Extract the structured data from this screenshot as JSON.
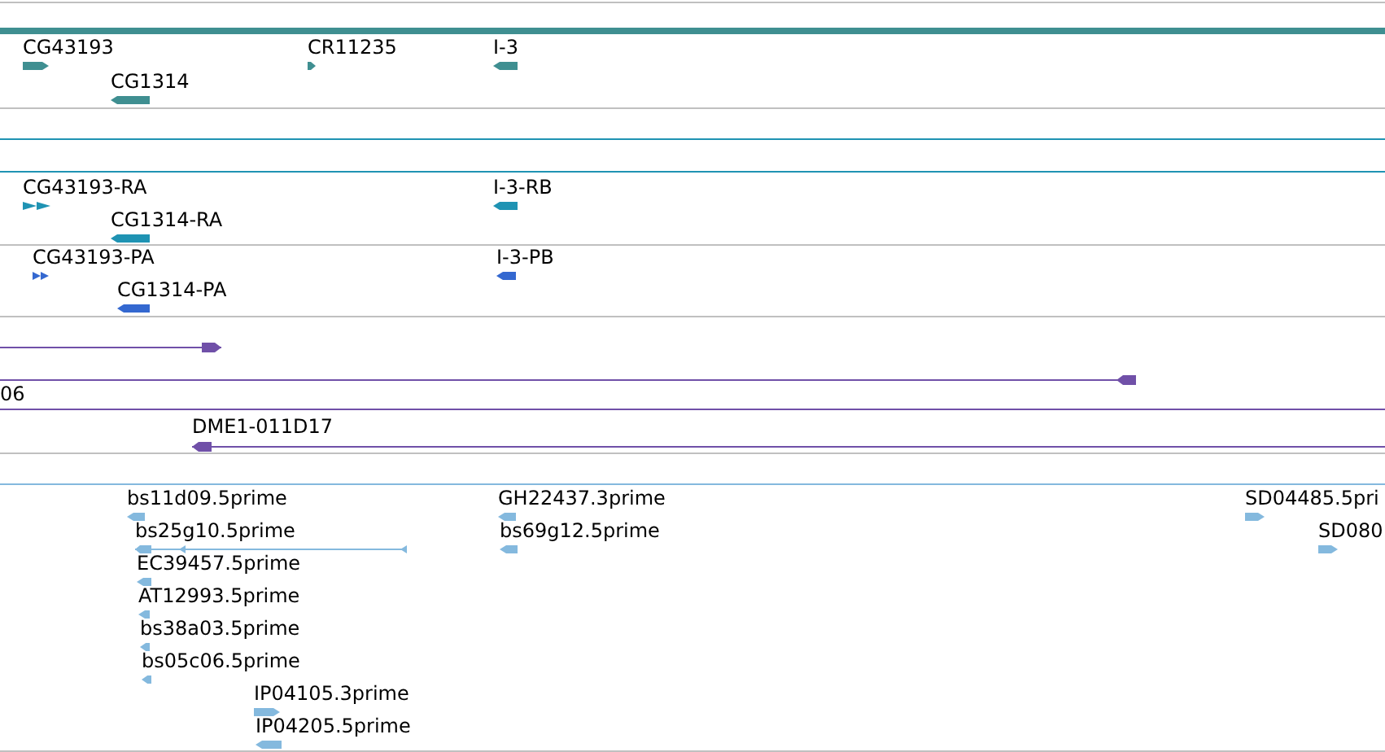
{
  "tracks": [
    {
      "color": "#3f8f91",
      "features": [
        {
          "kind": "bar"
        },
        {
          "kind": "arrow",
          "label": "CG43193",
          "reverse": false
        },
        {
          "kind": "arrow",
          "label": "CR11235",
          "reverse": false
        },
        {
          "kind": "arrow",
          "label": "I-3",
          "reverse": true
        },
        {
          "kind": "arrow",
          "label": "CG1314",
          "reverse": true
        }
      ]
    },
    {
      "color": "#1f93b3",
      "features": [
        {
          "kind": "span"
        },
        {
          "kind": "span"
        },
        {
          "kind": "double",
          "label": "CG43193-RA",
          "reverse": false
        },
        {
          "kind": "arrow",
          "label": "I-3-RB",
          "reverse": true
        },
        {
          "kind": "arrow",
          "label": "CG1314-RA",
          "reverse": true
        }
      ]
    },
    {
      "color": "#3468d0",
      "features": [
        {
          "kind": "double",
          "label": "CG43193-PA",
          "reverse": false
        },
        {
          "kind": "arrow",
          "label": "I-3-PB",
          "reverse": true
        },
        {
          "kind": "arrow",
          "label": "CG1314-PA",
          "reverse": true
        }
      ]
    },
    {
      "color": "#7050a8",
      "features": [
        {
          "kind": "line",
          "reverse": false
        },
        {
          "kind": "line",
          "reverse": true
        },
        {
          "kind": "span",
          "label": "06"
        },
        {
          "kind": "line",
          "label": "DME1-011D17",
          "reverse": true
        }
      ]
    },
    {
      "color": "#84b9de",
      "features": [
        {
          "kind": "span"
        },
        {
          "kind": "arrow",
          "label": "bs11d09.5prime",
          "reverse": true
        },
        {
          "kind": "linked",
          "label": "bs25g10.5prime",
          "reverse": true
        },
        {
          "kind": "arrow",
          "label": "EC39457.5prime",
          "reverse": true
        },
        {
          "kind": "arrow",
          "label": "AT12993.5prime",
          "reverse": true
        },
        {
          "kind": "arrow",
          "label": "bs38a03.5prime",
          "reverse": true
        },
        {
          "kind": "arrow",
          "label": "bs05c06.5prime",
          "reverse": true
        },
        {
          "kind": "arrow",
          "label": "IP04105.3prime",
          "reverse": false
        },
        {
          "kind": "arrow",
          "label": "IP04205.5prime",
          "reverse": true
        },
        {
          "kind": "arrow",
          "label": "GH22437.3prime",
          "reverse": true
        },
        {
          "kind": "arrow",
          "label": "bs69g12.5prime",
          "reverse": true
        },
        {
          "kind": "arrow",
          "label": "SD04485.5pri",
          "reverse": false
        },
        {
          "kind": "arrow",
          "label": "SD080",
          "reverse": false
        }
      ]
    }
  ]
}
